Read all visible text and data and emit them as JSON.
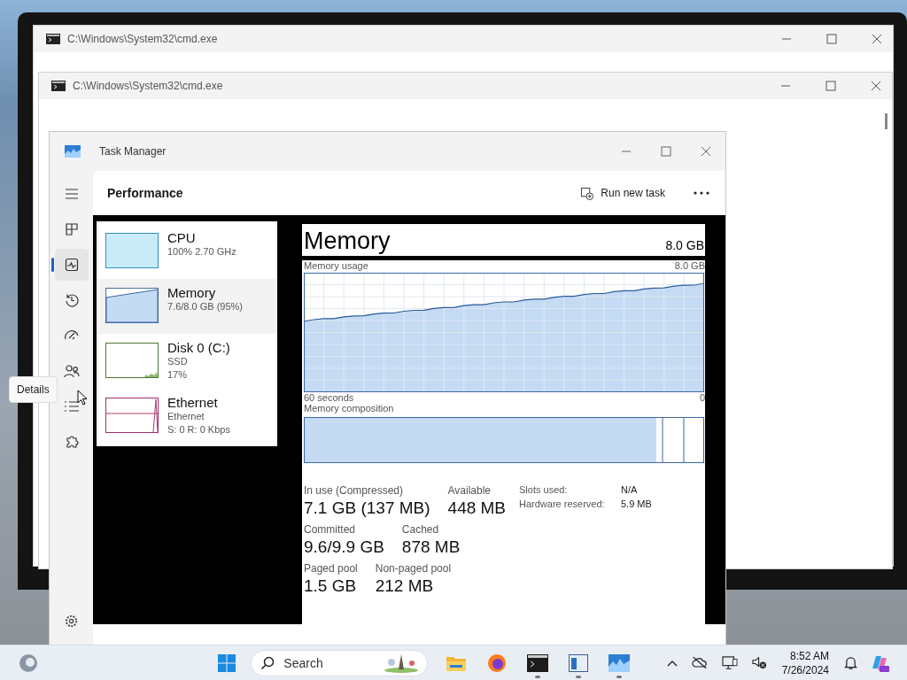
{
  "cmd_windows": [
    {
      "title": "C:\\Windows\\System32\\cmd.exe"
    },
    {
      "title": "C:\\Windows\\System32\\cmd.exe"
    }
  ],
  "task_manager": {
    "title": "Task Manager",
    "nav": [
      {
        "kind": "menu",
        "selected": false
      },
      {
        "kind": "processes",
        "selected": false
      },
      {
        "kind": "performance",
        "selected": true
      },
      {
        "kind": "history",
        "selected": false
      },
      {
        "kind": "startup",
        "selected": false
      },
      {
        "kind": "users",
        "selected": false
      },
      {
        "kind": "details",
        "selected": false
      },
      {
        "kind": "services",
        "selected": false
      }
    ],
    "tooltip": "Details",
    "page_title": "Performance",
    "run_new_task": "Run new task",
    "devices": [
      {
        "kind": "cpu",
        "name": "CPU",
        "lines": [
          "100%  2.70 GHz"
        ],
        "selected": false
      },
      {
        "kind": "memory",
        "name": "Memory",
        "lines": [
          "7.6/8.0 GB (95%)"
        ],
        "selected": true
      },
      {
        "kind": "disk",
        "name": "Disk 0 (C:)",
        "lines": [
          "SSD",
          "17%"
        ],
        "selected": false
      },
      {
        "kind": "ethernet",
        "name": "Ethernet",
        "lines": [
          "Ethernet",
          "S: 0  R: 0 Kbps"
        ],
        "selected": false
      }
    ],
    "memory": {
      "title": "Memory",
      "total": "8.0 GB",
      "usage_label": "Memory usage",
      "usage_max": "8.0 GB",
      "time_start": "60 seconds",
      "time_end": "0",
      "composition_label": "Memory composition",
      "stats": [
        [
          {
            "label": "In use (Compressed)",
            "value": "7.1 GB (137 MB)"
          },
          {
            "label": "Available",
            "value": "448 MB"
          }
        ],
        [
          {
            "label": "Committed",
            "value": "9.6/9.9 GB"
          },
          {
            "label": "Cached",
            "value": "878 MB"
          }
        ],
        [
          {
            "label": "Paged pool",
            "value": "1.5 GB"
          },
          {
            "label": "Non-paged pool",
            "value": "212 MB"
          }
        ]
      ],
      "details": [
        {
          "label": "Slots used:",
          "value": "N/A"
        },
        {
          "label": "Hardware reserved:",
          "value": "5.9 MB"
        }
      ]
    }
  },
  "taskbar": {
    "search_placeholder": "Search",
    "apps": [
      {
        "kind": "folder",
        "running": false
      },
      {
        "kind": "browser",
        "running": false
      },
      {
        "kind": "terminal",
        "running": true
      },
      {
        "kind": "window",
        "running": true
      },
      {
        "kind": "monitor",
        "running": true
      }
    ],
    "time": "8:52 AM",
    "date": "7/26/2024"
  }
}
